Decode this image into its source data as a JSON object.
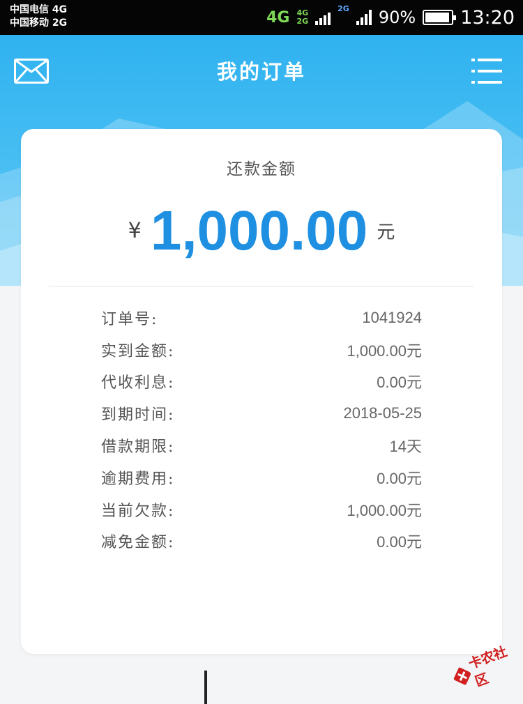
{
  "status_bar": {
    "carrier_1": "中国电信 4G",
    "carrier_2": "中国移动 2G",
    "network_primary": "4G",
    "network_stack_top": "4G",
    "network_stack_bottom": "2G",
    "network_secondary": "2G",
    "battery_percent": "90%",
    "time": "13:20"
  },
  "header": {
    "title": "我的订单",
    "left_icon": "mail-icon",
    "right_icon": "menu-icon",
    "background_color": "#2fb2f0"
  },
  "card": {
    "amount_label": "还款金额",
    "currency_symbol": "¥",
    "amount": "1,000.00",
    "amount_unit": "元",
    "accent_color": "#1e8fe1"
  },
  "details": [
    {
      "label": "订单号:",
      "value": "1041924"
    },
    {
      "label": "实到金额:",
      "value": "1,000.00元"
    },
    {
      "label": "代收利息:",
      "value": "0.00元"
    },
    {
      "label": "到期时间:",
      "value": "2018-05-25"
    },
    {
      "label": "借款期限:",
      "value": "14天"
    },
    {
      "label": "逾期费用:",
      "value": "0.00元"
    },
    {
      "label": "当前欠款:",
      "value": "1,000.00元"
    },
    {
      "label": "减免金额:",
      "value": "0.00元"
    }
  ],
  "watermark": {
    "text": "卡农社区",
    "icon": "kanong-logo-icon"
  }
}
